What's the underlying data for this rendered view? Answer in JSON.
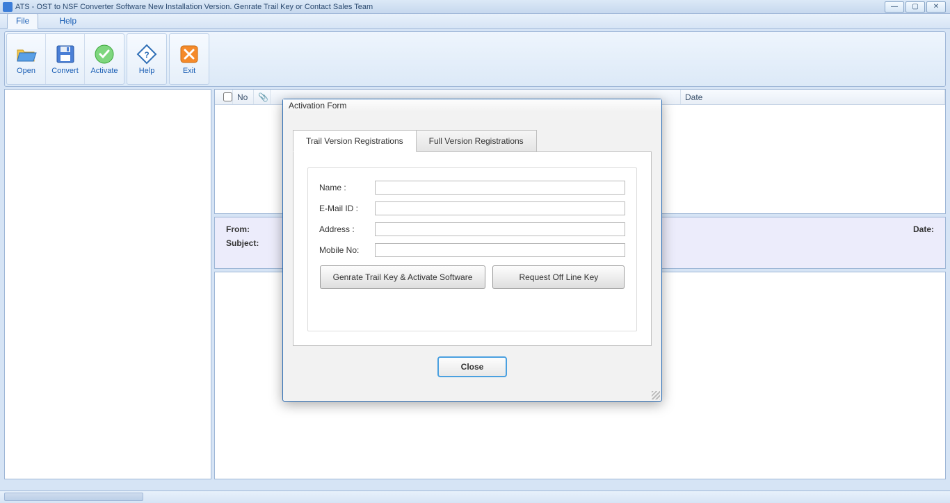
{
  "titlebar": {
    "title": "ATS - OST to NSF Converter Software New Installation Version. Genrate Trail Key or Contact Sales Team"
  },
  "menu": {
    "file": "File",
    "help": "Help"
  },
  "ribbon": {
    "open": "Open",
    "convert": "Convert",
    "activate": "Activate",
    "help": "Help",
    "exit": "Exit"
  },
  "list": {
    "col_no": "No",
    "col_date": "Date"
  },
  "details": {
    "from": "From:",
    "subject": "Subject:",
    "date": "Date:"
  },
  "dialog": {
    "title": "Activation Form",
    "tab_trail": "Trail Version Registrations",
    "tab_full": "Full Version Registrations",
    "name": "Name :",
    "email": "E-Mail ID :",
    "address": "Address :",
    "mobile": "Mobile No:",
    "btn_generate": "Genrate Trail Key & Activate Software",
    "btn_request": "Request Off Line Key",
    "close": "Close"
  },
  "form_values": {
    "name": "",
    "email": "",
    "address": "",
    "mobile": ""
  }
}
